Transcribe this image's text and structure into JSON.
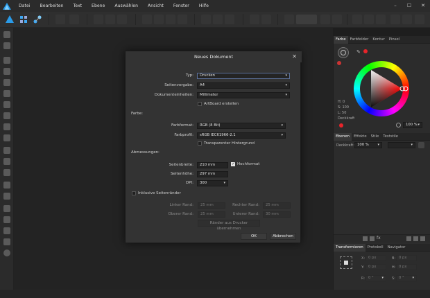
{
  "menu": [
    "Datei",
    "Bearbeiten",
    "Text",
    "Ebene",
    "Auswählen",
    "Ansicht",
    "Fenster",
    "Hilfe"
  ],
  "window_controls": [
    "–",
    "☐",
    "✕"
  ],
  "right_panel": {
    "top_tabs": [
      "Farbe",
      "Farbfelder",
      "Kontur",
      "Pinsel"
    ],
    "hsl": [
      "H: 0",
      "S: 100",
      "L: 50"
    ],
    "opacity_label": "Deckkraft",
    "opacity_value": "100 %",
    "layer_tabs": [
      "Ebenen",
      "Effekte",
      "Stile",
      "Textstile"
    ],
    "layer_opacity_label": "Deckkraft:",
    "layer_opacity_value": "100 %",
    "transform_tabs": [
      "Transformieren",
      "Protokoll",
      "Navigator"
    ],
    "transform_fields": [
      {
        "label": "X:",
        "value": "0 px"
      },
      {
        "label": "B:",
        "value": "0 px"
      },
      {
        "label": "Y:",
        "value": "0 px"
      },
      {
        "label": "H:",
        "value": "0 px"
      },
      {
        "label": "R:",
        "value": "0 °"
      },
      {
        "label": "S:",
        "value": "0 °"
      }
    ],
    "accent_red": "#e8242a"
  },
  "dialog": {
    "title": "Neues Dokument",
    "close": "✕",
    "typ_label": "Typ:",
    "typ_value": "Drucken",
    "vorgabe_label": "Seitenvorgabe:",
    "vorgabe_value": "A4",
    "einheiten_label": "Dokumenteinheiten:",
    "einheiten_value": "Millimeter",
    "artboard_label": "ArtBoard erstellen",
    "farbe_section": "Farbe:",
    "farbformat_label": "Farbformat:",
    "farbformat_value": "RGB (8 Bit)",
    "farbprofil_label": "Farbprofil:",
    "farbprofil_value": "sRGB IEC61966-2.1",
    "transparent_label": "Transparenter Hintergrund",
    "abm_section": "Abmessungen:",
    "breite_label": "Seitenbreite:",
    "breite_value": "210 mm",
    "hochformat_label": "Hochformat",
    "hoehe_label": "Seitenhöhe:",
    "hoehe_value": "297 mm",
    "dpi_label": "DPI:",
    "dpi_value": "300",
    "raender_label": "Inklusive Seitenränder",
    "linker_label": "Linker Rand:",
    "linker_value": "25 mm",
    "rechter_label": "Rechter Rand:",
    "rechter_value": "25 mm",
    "oberer_label": "Oberer Rand:",
    "oberer_value": "25 mm",
    "unterer_label": "Unterer Rand:",
    "unterer_value": "30 mm",
    "drucker_button": "Ränder aus Drucker übernehmen",
    "ok_button": "OK",
    "cancel_button": "Abbrechen"
  }
}
